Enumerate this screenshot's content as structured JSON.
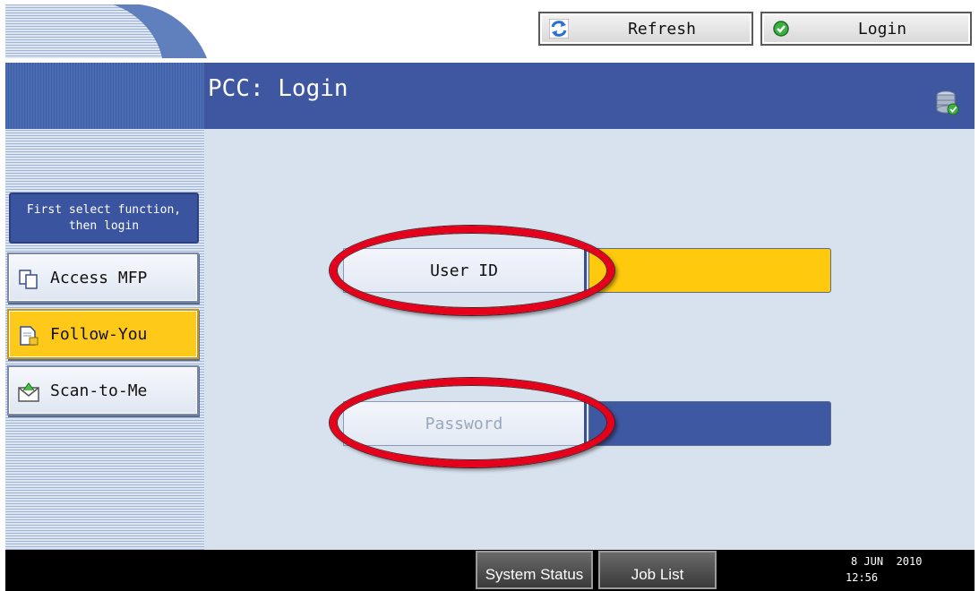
{
  "header": {
    "refresh_label": "Refresh",
    "login_label": "Login"
  },
  "title": "PCC: Login",
  "sidebar": {
    "hint": "First select function, then login",
    "items": [
      {
        "label": "Access MFP",
        "icon": "document-copy-icon",
        "selected": false
      },
      {
        "label": "Follow-You",
        "icon": "document-lock-icon",
        "selected": true
      },
      {
        "label": "Scan-to-Me",
        "icon": "envelope-scan-icon",
        "selected": false
      }
    ]
  },
  "form": {
    "user_id_label": "User ID",
    "password_label": "Password"
  },
  "footer": {
    "system_status_label": "System Status",
    "job_list_label": "Job List",
    "date": "8 JUN  2010",
    "time": "12:56"
  },
  "colors": {
    "title_bar": "#3e57a0",
    "selected": "#ffc91a",
    "highlight_ring": "#e5001c",
    "content_bg": "#d8e2ef"
  }
}
